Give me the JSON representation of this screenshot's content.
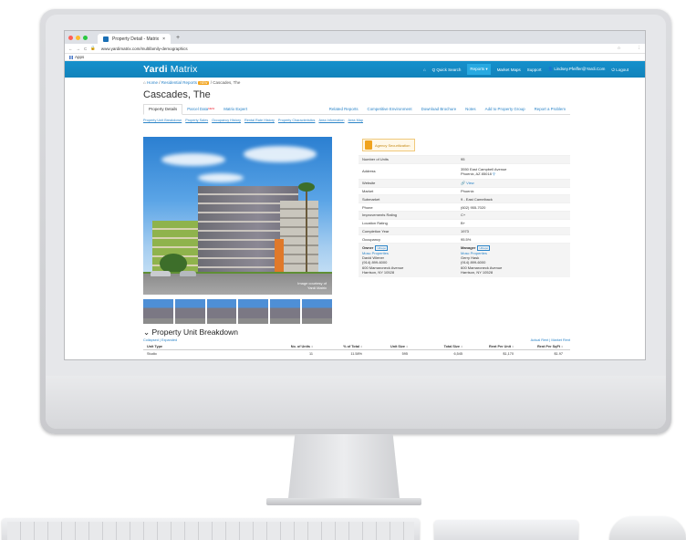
{
  "browser": {
    "tab_title": "Property Detail - Matrix",
    "new_tab": "+",
    "url": "www.yardimatrix.com/multifamily-demographics",
    "bookmarks_label": "Apps"
  },
  "header": {
    "logo_bold": "Yardi",
    "logo_rest": " Matrix",
    "nav": {
      "quick_search": "Q Quick Search",
      "reports": "Reports ▾",
      "market_maps": "Market Maps",
      "support": "Support",
      "user": "Lindsey.Pfeiffer@Yardi.Com",
      "logout": "Logout"
    }
  },
  "breadcrumb": {
    "home": "Home",
    "section": "Residential Reports",
    "tag": "NEW",
    "current": "Cascades, The"
  },
  "page_title": "Cascades, The",
  "tabs": {
    "property_details": "Property Details",
    "parcel_data": "Parcel Data",
    "parcel_new": "NEW",
    "matrix_expert": "Matrix Expert",
    "related_reports": "Related Reports",
    "competitive": "Competitive Environment",
    "brochure": "Download Brochure",
    "notes": "Notes",
    "add_group": "Add to Property Group",
    "report_problem": "Report a Problem"
  },
  "sublinks": [
    "Property Unit Breakdown",
    "Property Sales",
    "Occupancy History",
    "Rental Rate History",
    "Property Characteristics",
    "Area Information",
    "Area Map"
  ],
  "photo": {
    "credit_line": "Image courtesy of",
    "credit_brand": "Yardi Matrix"
  },
  "agency": "Agency Securitization",
  "info": {
    "rows": [
      {
        "k": "Number of Units",
        "v": "95"
      },
      {
        "k": "Address",
        "v": "3550 East Campbell Avenue",
        "v2": "Phoenix, AZ 85018"
      },
      {
        "k": "Website",
        "v": "View"
      },
      {
        "k": "Market",
        "v": "Phoenix"
      },
      {
        "k": "Submarket",
        "v": "9 - East Camelback"
      },
      {
        "k": "Phone",
        "v": "(602) 955-7020"
      },
      {
        "k": "Improvements Rating",
        "v": "C+"
      },
      {
        "k": "Location Rating",
        "v": "B+"
      },
      {
        "k": "Completion Year",
        "v": "1973"
      },
      {
        "k": "Occupancy",
        "v": "95.5%"
      }
    ],
    "owner": {
      "label": "Owner",
      "badge": "Ultrepo",
      "link": "Mosс Properties",
      "name": "David Wiener",
      "phone": "(914) 899-6000",
      "addr1": "600 Mamaroneck Avenue",
      "addr2": "Harrison, NY 10528"
    },
    "manager": {
      "label": "Manager",
      "badge": "Ultrepo",
      "link": "Mosс Properties",
      "name": "Gerry Hask",
      "phone": "(914) 899-6000",
      "addr1": "600 Mamaroneck Avenue",
      "addr2": "Harrison, NY 10528"
    }
  },
  "breakdown": {
    "title": "Property Unit Breakdown",
    "collapsed": "Collapsed",
    "expanded": "Expanded",
    "rent_links": "Actual Rent | Market Rent",
    "columns": [
      "Unit Type",
      "No. of Units ↕",
      "% of Total ↕",
      "Unit Size ↕",
      "Total Size ↕",
      "Rent Per Unit ↕",
      "Rent Per SqFt ↕"
    ],
    "rows": [
      [
        "Studio",
        "11",
        "11.58%",
        "595",
        "6,545",
        "$1,170",
        "$1.97"
      ]
    ]
  }
}
